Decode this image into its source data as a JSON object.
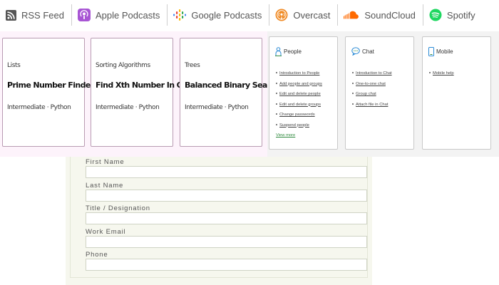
{
  "podcast_bar": {
    "items": [
      {
        "label": "RSS Feed",
        "icon": "rss-icon",
        "color": "#555555"
      },
      {
        "label": "Apple Podcasts",
        "icon": "apple-podcasts-icon",
        "color": "#a855d4"
      },
      {
        "label": "Google Podcasts",
        "icon": "google-podcasts-icon",
        "color": "#4285f4"
      },
      {
        "label": "Overcast",
        "icon": "overcast-icon",
        "color": "#f08a24"
      },
      {
        "label": "SoundCloud",
        "icon": "soundcloud-icon",
        "color": "#ff6a00"
      },
      {
        "label": "Spotify",
        "icon": "spotify-icon",
        "color": "#1ed760"
      }
    ]
  },
  "problem_cards": [
    {
      "category": "Lists",
      "title": "Prime Number Finder",
      "meta": "Intermediate · Python"
    },
    {
      "category": "Sorting Algorithms",
      "title": "Find Xth Number In Order",
      "meta": "Intermediate · Python"
    },
    {
      "category": "Trees",
      "title": "Balanced Binary Search Tree",
      "meta": "Intermediate · Python"
    }
  ],
  "help_cards": [
    {
      "title": "People",
      "icon": "person-icon",
      "links": [
        "Introduction to People",
        "Add people and groups",
        "Edit and delete people",
        "Edit and delete groups",
        "Change passwords",
        "Suspend people"
      ],
      "view_more": "View more"
    },
    {
      "title": "Chat",
      "icon": "chat-icon",
      "links": [
        "Introduction to Chat",
        "One-to-one chat",
        "Group chat",
        "Attach file in Chat"
      ]
    },
    {
      "title": "Mobile",
      "icon": "mobile-icon",
      "links": [
        "Mobile help"
      ]
    }
  ],
  "form": {
    "fields": [
      {
        "label": "First Name",
        "value": ""
      },
      {
        "label": "Last Name",
        "value": ""
      },
      {
        "label": "Title / Designation",
        "value": ""
      },
      {
        "label": "Work Email",
        "value": ""
      },
      {
        "label": "Phone",
        "value": ""
      }
    ]
  }
}
